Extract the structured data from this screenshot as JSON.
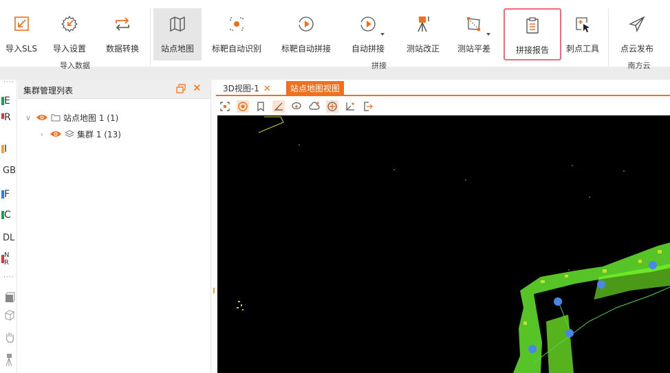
{
  "ribbon": {
    "buttons": [
      {
        "id": "import-sls",
        "label": "导入SLS",
        "icon": "import-arrow-icon"
      },
      {
        "id": "import-settings",
        "label": "导入设置",
        "icon": "gear-import-icon"
      },
      {
        "id": "data-convert",
        "label": "数据转换",
        "icon": "convert-arrows-icon"
      },
      {
        "id": "station-map",
        "label": "站点地图",
        "icon": "map-icon"
      },
      {
        "id": "target-auto-detect",
        "label": "标靶自动识别",
        "icon": "target-detect-icon"
      },
      {
        "id": "target-auto-register",
        "label": "标靶自动拼接",
        "icon": "play-circle-icon"
      },
      {
        "id": "auto-register",
        "label": "自动拼接",
        "icon": "play-circle-icon"
      },
      {
        "id": "station-correct",
        "label": "测站改正",
        "icon": "tripod-scanner-icon"
      },
      {
        "id": "station-adjust",
        "label": "测站平差",
        "icon": "adjust-square-icon"
      },
      {
        "id": "register-report",
        "label": "拼接报告",
        "icon": "clipboard-report-icon"
      },
      {
        "id": "pick-point-tool",
        "label": "刺点工具",
        "icon": "pick-cursor-icon"
      },
      {
        "id": "pointcloud-publish",
        "label": "点云发布",
        "icon": "paper-plane-icon"
      }
    ],
    "groups": {
      "import": "导入数据",
      "register": "拼接",
      "cloud": "南方云"
    }
  },
  "vtoolbar": {
    "items": [
      "E",
      "R",
      "I",
      "GB",
      "F",
      "C",
      "DL",
      "N R"
    ]
  },
  "panel": {
    "title": "集群管理列表",
    "tree": {
      "root_label": "站点地图 1 (1)",
      "child_label": "集群 1 (13)"
    }
  },
  "views": {
    "tabs": [
      {
        "label": "3D视图-1",
        "active": false
      },
      {
        "label": "站点地图视图",
        "active": true
      }
    ]
  },
  "colors": {
    "accent": "#f07020",
    "highlight_border": "#f06a78",
    "pointcloud": "#7cff2a",
    "station_marker": "#4a86e8"
  }
}
